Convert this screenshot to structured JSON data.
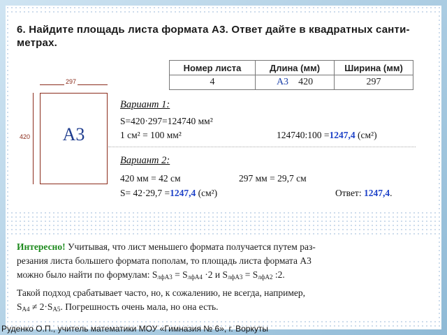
{
  "problem": {
    "number": "6.",
    "text": "Найдите площадь листа формата А3. Ответ дайте в квадратных санти-",
    "text_line2": "метрах."
  },
  "table": {
    "headers": [
      "Номер листа",
      "Длина (мм)",
      "Ширина (мм)"
    ],
    "row": {
      "number": "4",
      "length_tag": "А3",
      "length": "420",
      "width": "297"
    }
  },
  "drawing": {
    "sheet_label": "А3",
    "width_label": "297",
    "height_label": "420"
  },
  "variant1": {
    "title": "Вариант 1:",
    "line1": "S=420·297=124740 мм²",
    "line2_left": "1 см² = 100 мм²",
    "line2_calc": "124740:100 =",
    "line2_result": "1247,4",
    "line2_unit": "(см²)"
  },
  "variant2": {
    "title": "Вариант 2:",
    "line1_left": "420 мм = 42 см",
    "line1_right": "297 мм = 29,7 см",
    "line2_calc": "S= 42·29,7 =",
    "line2_result": "1247,4",
    "line2_unit": "(см²)",
    "answer_label": "Ответ:",
    "answer_value": "1247,4",
    "answer_end": "."
  },
  "interesting": {
    "label": "Интересно!",
    "line1": " Учитывая, что лист меньшего формата получается путем раз-",
    "line2": "резания листа большего формата пополам, то площадь листа формата А3",
    "line3": "можно было найти по формулам:  S",
    "f1_sub": "лфА3",
    "f1_mid": " = S",
    "f1_sub2": "лфА4",
    "f1_end": " ·2  и  S",
    "f2_sub": "лфА3",
    "f2_mid": " = S",
    "f2_sub2": "лфА2",
    "f2_end": " :2.",
    "line4": "Такой подход срабатывает часто, но, к сожалению, не всегда, например,",
    "line5_a": "S",
    "line5_sub1": "А4",
    "line5_b": " ≠ 2·S",
    "line5_sub2": "А5",
    "line5_c": ". Погрешность очень мала, но она есть."
  },
  "footer": "Руденко О.П., учитель математики МОУ «Гимназия № 6», г. Воркуты"
}
